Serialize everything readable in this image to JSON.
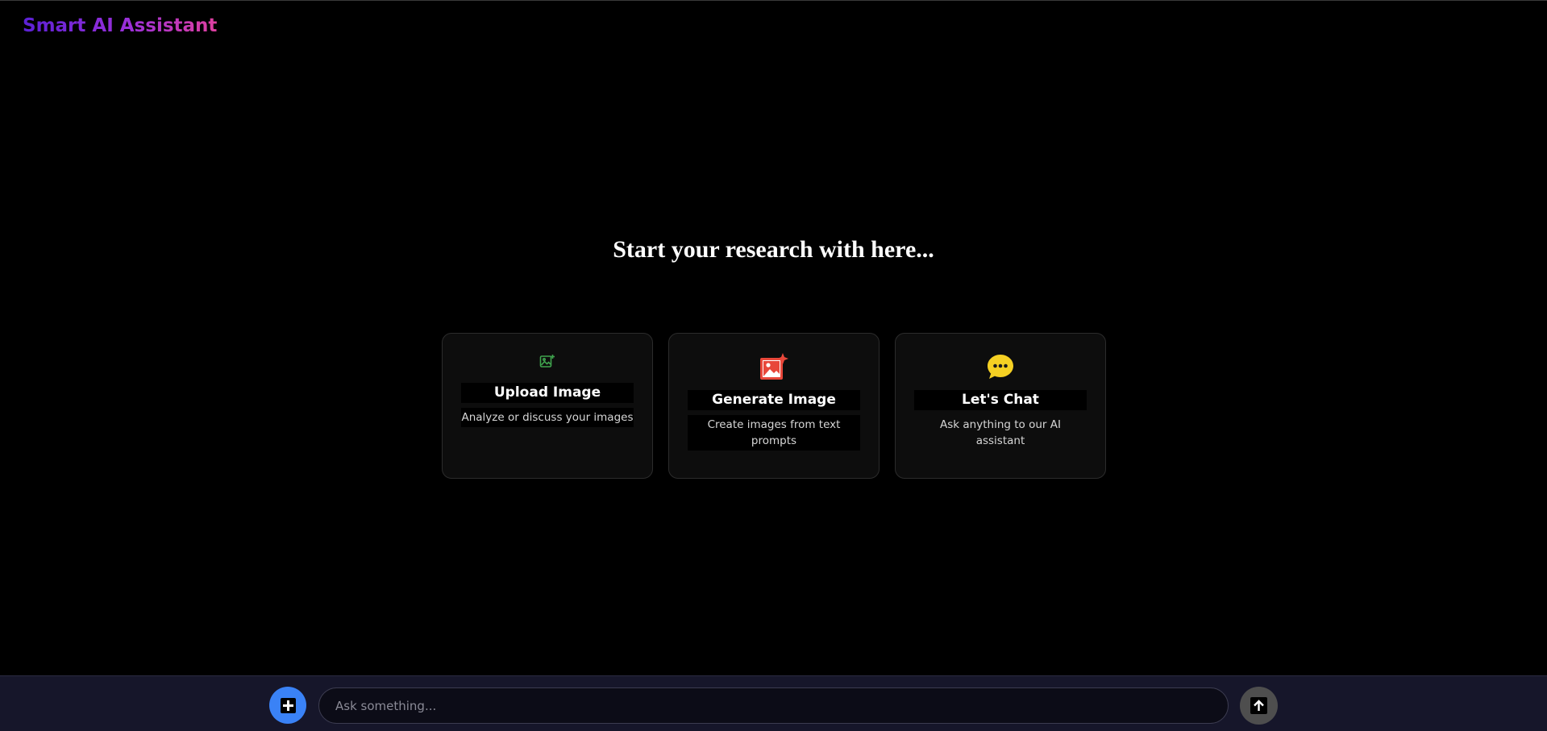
{
  "app": {
    "title": "Smart AI Assistant"
  },
  "main": {
    "headline": "Start your research with here..."
  },
  "cards": [
    {
      "title": "Upload Image",
      "description": "Analyze or discuss your images",
      "icon": "image-plus-icon",
      "icon_color": "#3fa34d"
    },
    {
      "title": "Generate Image",
      "description": "Create images from text prompts",
      "icon": "image-sparkle-icon",
      "icon_color": "#e8473a"
    },
    {
      "title": "Let's Chat",
      "description": "Ask anything to our AI assistant",
      "icon": "chat-bubble-icon",
      "icon_color": "#f5d023"
    }
  ],
  "composer": {
    "placeholder": "Ask something...",
    "value": "",
    "add_icon": "plus-icon",
    "send_icon": "arrow-up-icon"
  },
  "colors": {
    "background": "#000000",
    "bottom_bar": "#16162a",
    "accent_blue": "#3a82f6",
    "brand_gradient_start": "#5b21d6",
    "brand_gradient_end": "#e040a0"
  }
}
